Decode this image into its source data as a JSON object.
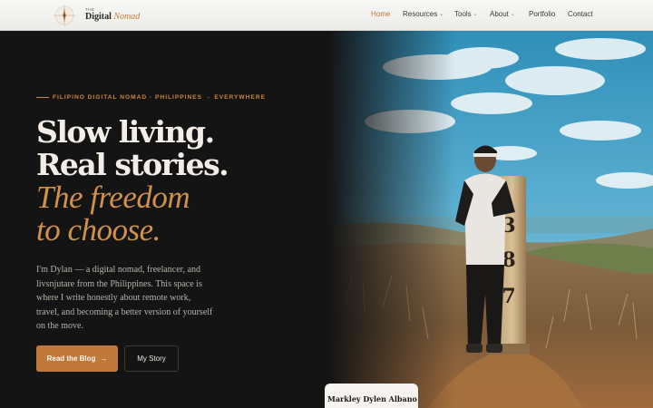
{
  "header": {
    "logo": {
      "small": "THE",
      "main": "Digital",
      "accent": "Nomad"
    },
    "nav": [
      {
        "label": "Home",
        "active": true
      },
      {
        "label": "Resources",
        "dropdown": true
      },
      {
        "label": "Tools",
        "dropdown": true
      },
      {
        "label": "About",
        "dropdown": true
      },
      {
        "label": "Portfolio"
      },
      {
        "label": "Contact"
      }
    ]
  },
  "hero": {
    "eyebrow": "FILIPINO DIGITAL NOMAD · PHILIPPINES → EVERYWHERE",
    "headline": [
      "Slow living.",
      "Real stories."
    ],
    "headline_accent": [
      "The freedom",
      "to choose."
    ],
    "bio": "I'm Dylan — a digital nomad, freelancer, and livsnjutare from the Philippines. This space is where I write honestly about remote work, travel, and becoming a better version of yourself on the move.",
    "primary_button": "Read the Blog",
    "secondary_button": "My Story",
    "photo_caption": "Markley Dylen Albano",
    "post_marker": "387"
  },
  "colors": {
    "accent": "#c0773a",
    "background": "#141414",
    "headline": "#f2ede6"
  },
  "icons": {
    "primary_button": "arrow-right-icon",
    "dropdown": "chevron-down-icon",
    "logo": "compass-icon"
  }
}
